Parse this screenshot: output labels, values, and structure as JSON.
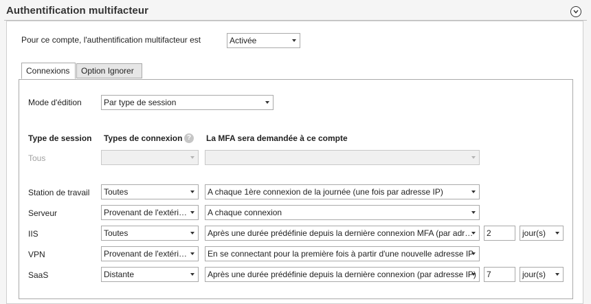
{
  "section": {
    "title": "Authentification multifacteur"
  },
  "account": {
    "label": "Pour ce compte, l'authentification multifacteur est",
    "status_value": "Activée"
  },
  "tabs": [
    {
      "label": "Connexions",
      "active": true
    },
    {
      "label": "Option Ignorer",
      "active": false
    }
  ],
  "edit_mode": {
    "label": "Mode d'édition",
    "value": "Par type de session"
  },
  "table": {
    "headers": {
      "session_type": "Type de session",
      "connection_types": "Types de connexion",
      "mfa_required": "La MFA sera demandée à ce compte"
    },
    "all_row": {
      "label": "Tous",
      "connection_type": "",
      "mfa": ""
    },
    "rows": [
      {
        "session": "Station de travail",
        "connection_type": "Toutes",
        "mfa": "A chaque 1ère connexion de la journée (une fois par adresse IP)",
        "number": null,
        "unit": null
      },
      {
        "session": "Serveur",
        "connection_type": "Provenant de l'extéri…",
        "mfa": "A chaque connexion",
        "number": null,
        "unit": null
      },
      {
        "session": "IIS",
        "connection_type": "Toutes",
        "mfa": "Après une durée prédéfinie depuis la dernière connexion MFA (par adr…",
        "number": "2",
        "unit": "jour(s)"
      },
      {
        "session": "VPN",
        "connection_type": "Provenant de l'extéri…",
        "mfa": "En se connectant pour la première fois à partir d'une nouvelle adresse IP",
        "number": null,
        "unit": null
      },
      {
        "session": "SaaS",
        "connection_type": "Distante",
        "mfa": "Après une durée prédéfinie depuis la dernière connexion (par adresse IP)",
        "number": "7",
        "unit": "jour(s)"
      }
    ]
  },
  "icons": {
    "collapse": "chevron-down-circle-icon",
    "help": "question-mark-icon"
  }
}
